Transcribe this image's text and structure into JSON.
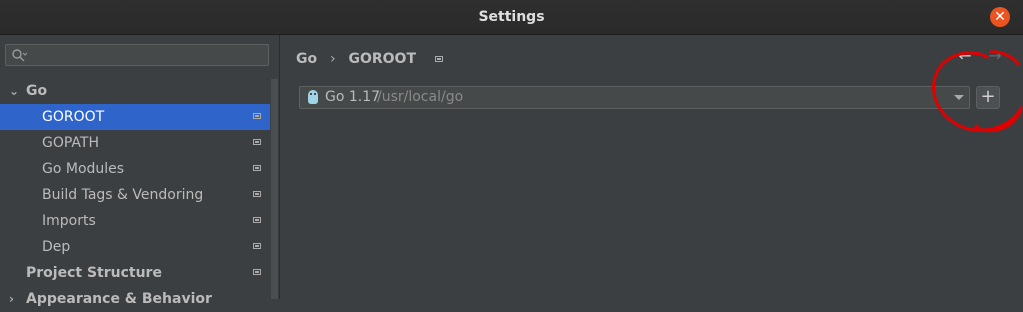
{
  "window": {
    "title": "Settings",
    "close_icon": "close-icon"
  },
  "search": {
    "placeholder": "",
    "icon": "search-icon"
  },
  "sidebar": {
    "items": [
      {
        "label": "Go",
        "level": 0,
        "expanded": true,
        "selected": false,
        "bold": true
      },
      {
        "label": "GOROOT",
        "level": 1,
        "selected": true
      },
      {
        "label": "GOPATH",
        "level": 1,
        "selected": false
      },
      {
        "label": "Go Modules",
        "level": 1,
        "selected": false
      },
      {
        "label": "Build Tags & Vendoring",
        "level": 1,
        "selected": false
      },
      {
        "label": "Imports",
        "level": 1,
        "selected": false
      },
      {
        "label": "Dep",
        "level": 1,
        "selected": false
      },
      {
        "label": "Project Structure",
        "level": 0,
        "selected": false,
        "bold": true
      },
      {
        "label": "Appearance & Behavior",
        "level": 0,
        "selected": false,
        "bold": true
      }
    ]
  },
  "breadcrumb": {
    "parent": "Go",
    "separator": "›",
    "current": "GOROOT"
  },
  "nav": {
    "back": "←",
    "forward": "→"
  },
  "sdk": {
    "name": "Go 1.17",
    "path": "/usr/local/go",
    "icon": "gopher-icon"
  },
  "add_button": {
    "label": "+"
  },
  "colors": {
    "accent": "#2f65ca",
    "background": "#3c3f41",
    "annotation": "#e00000",
    "close": "#e95420"
  }
}
